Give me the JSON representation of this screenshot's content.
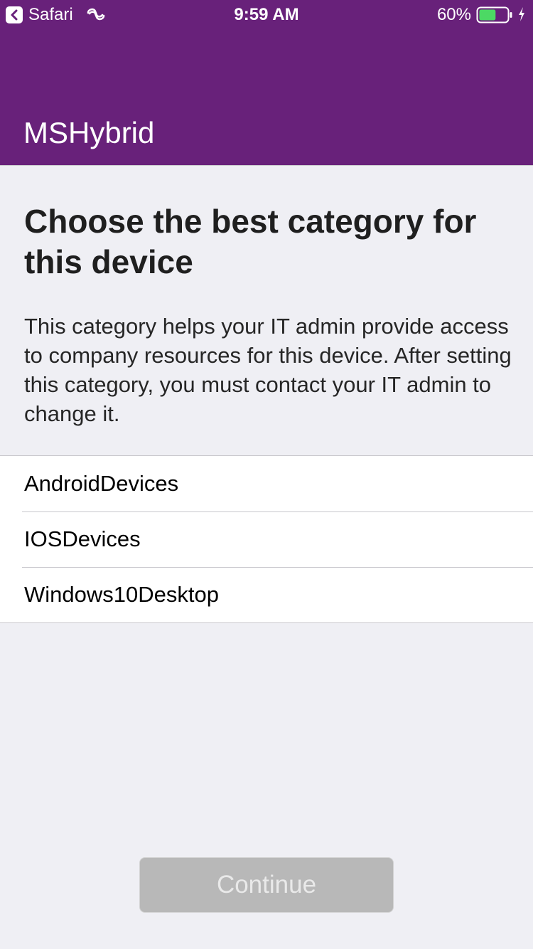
{
  "status_bar": {
    "back_app": "Safari",
    "time": "9:59 AM",
    "battery_percent": "60%",
    "battery_level": 0.6,
    "icons": [
      "back-chevron-icon",
      "link-icon",
      "battery-icon",
      "charging-bolt-icon"
    ]
  },
  "header": {
    "title": "MSHybrid",
    "background_color": "#68217A"
  },
  "main": {
    "heading": "Choose the best category for this device",
    "description": "This category helps your IT admin provide access to company resources for this device. After setting this category, you must contact your IT admin to change it.",
    "categories": [
      {
        "label": "AndroidDevices"
      },
      {
        "label": "IOSDevices"
      },
      {
        "label": "Windows10Desktop"
      }
    ]
  },
  "footer": {
    "continue_label": "Continue",
    "continue_enabled": false
  }
}
